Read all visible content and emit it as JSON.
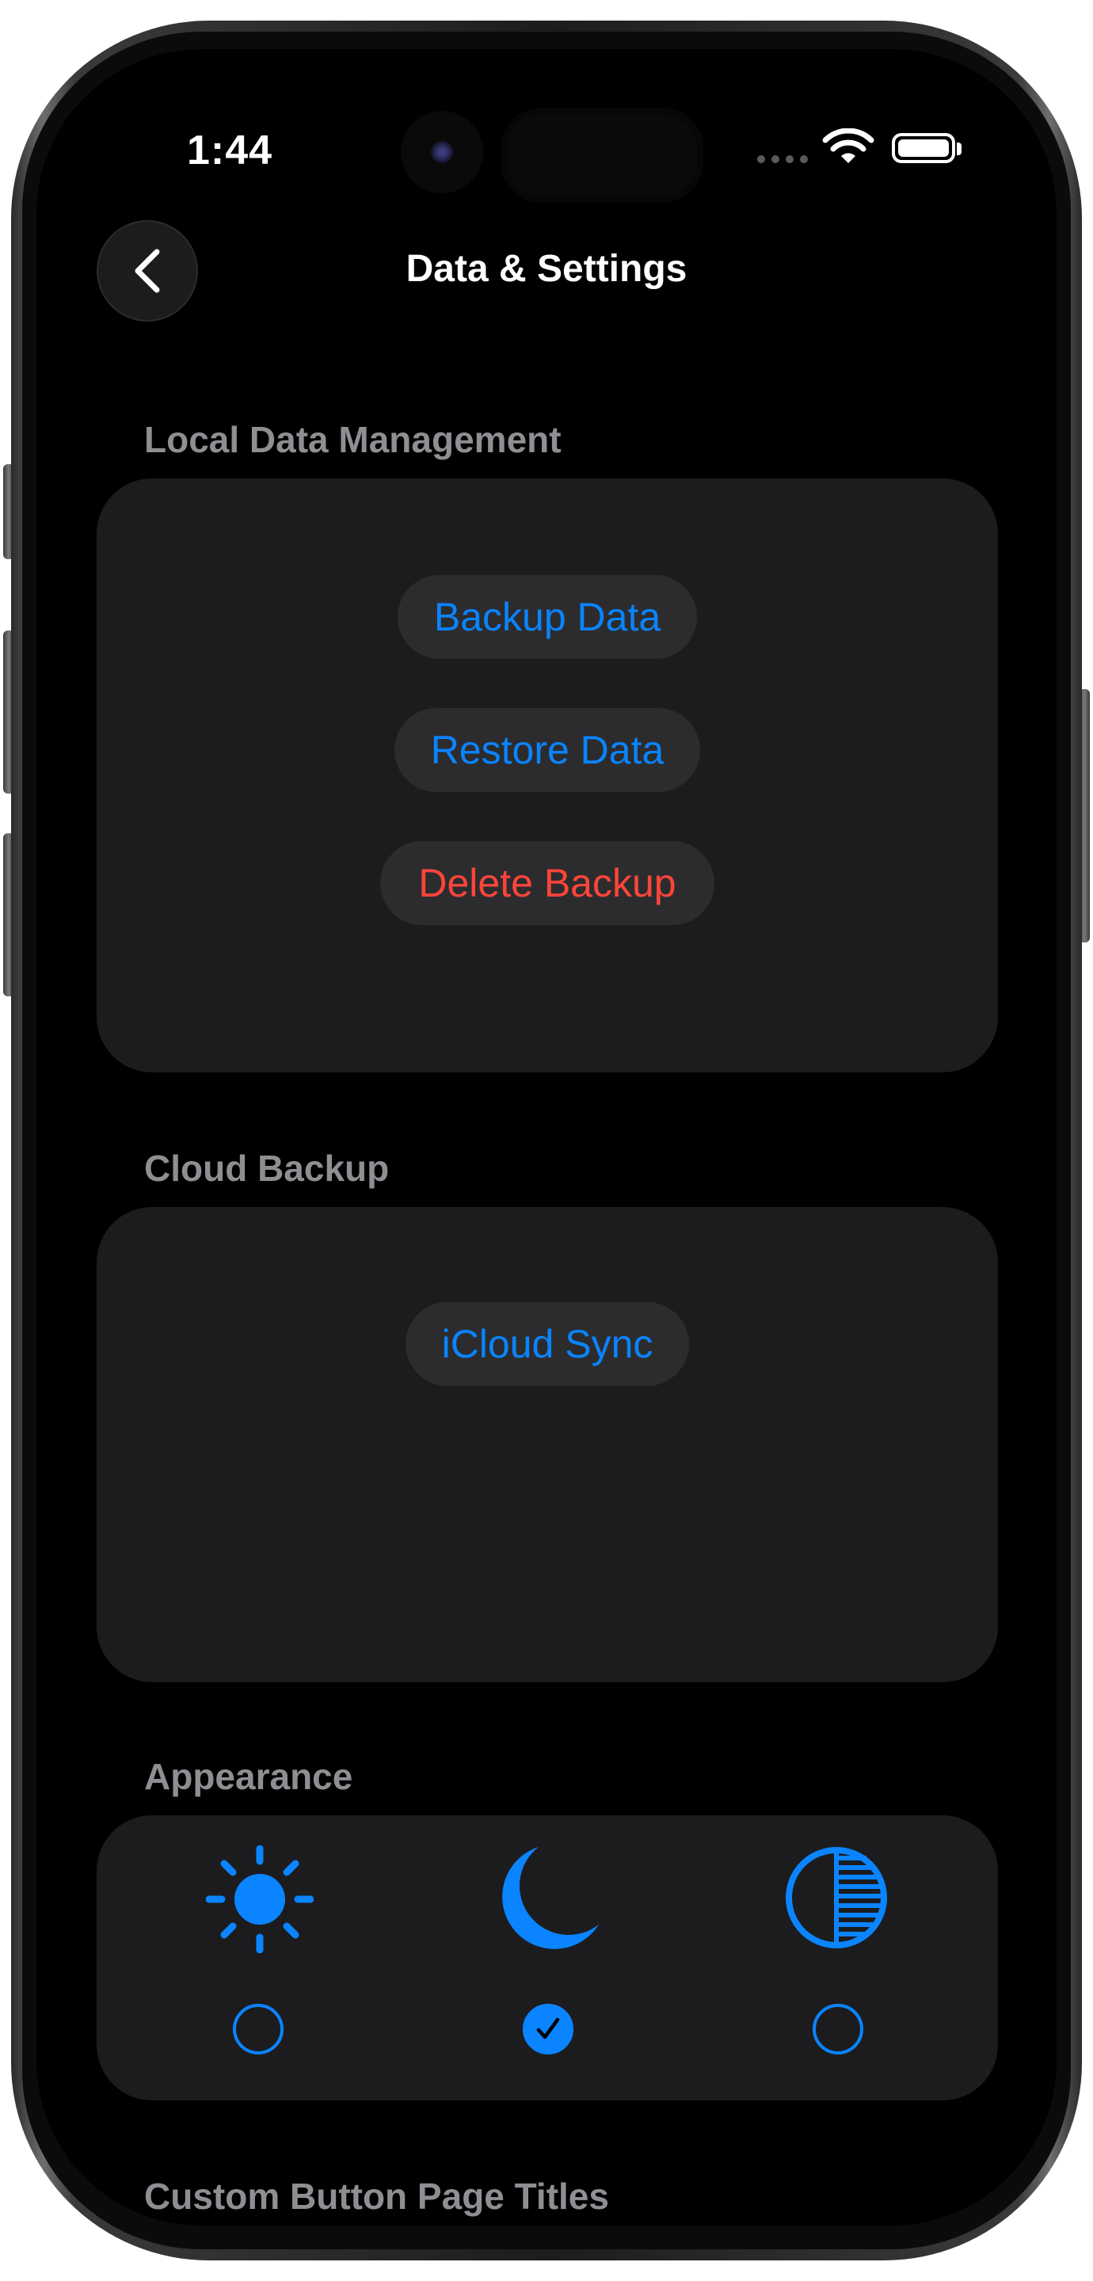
{
  "status_bar": {
    "time": "1:44"
  },
  "nav": {
    "title": "Data & Settings",
    "back_icon": "chevron-left-icon"
  },
  "sections": {
    "local": {
      "header": "Local Data Management",
      "buttons": [
        {
          "label": "Backup Data",
          "color": "#0a84ff"
        },
        {
          "label": "Restore Data",
          "color": "#0a84ff"
        },
        {
          "label": "Delete Backup",
          "color": "#ff453a"
        }
      ]
    },
    "cloud": {
      "header": "Cloud Backup",
      "buttons": [
        {
          "label": "iCloud Sync",
          "color": "#0a84ff"
        }
      ]
    },
    "appearance": {
      "header": "Appearance",
      "options": [
        {
          "icon": "sun-icon",
          "selected": false
        },
        {
          "icon": "moon-icon",
          "selected": true
        },
        {
          "icon": "auto-contrast-icon",
          "selected": false
        }
      ]
    },
    "custom_titles": {
      "header": "Custom Button Page Titles"
    }
  },
  "colors": {
    "accent": "#0a84ff",
    "destructive": "#ff453a",
    "card": "#1c1c1e",
    "pill": "#2c2c2e",
    "header_text": "#8e8e93"
  }
}
